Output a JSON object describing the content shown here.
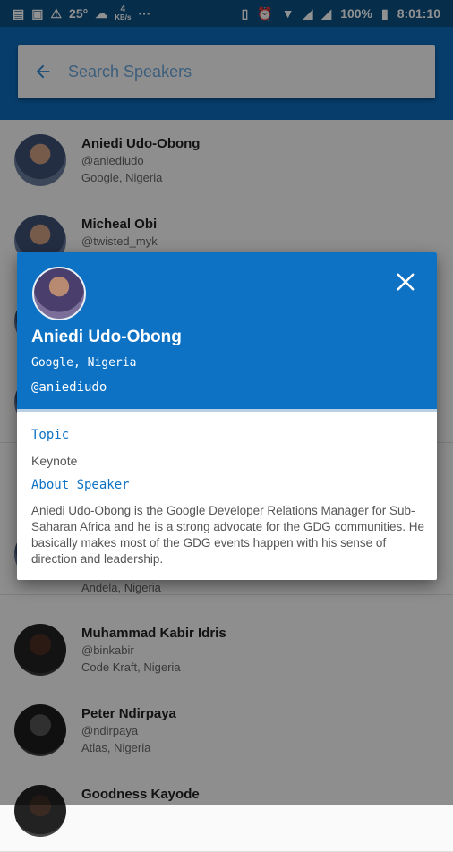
{
  "status_bar": {
    "temperature": "25°",
    "net_speed": "4",
    "net_unit": "KB/s",
    "dots": "···",
    "battery": "100%",
    "time": "8:01:10"
  },
  "search": {
    "placeholder": "Search Speakers"
  },
  "speakers": [
    {
      "name": "Aniedi Udo-Obong",
      "handle": "@aniediudo",
      "company": "Google, Nigeria"
    },
    {
      "name": "Micheal Obi",
      "handle": "@twisted_myk",
      "company": ""
    },
    {
      "name": "",
      "handle": "",
      "company": "Andela, Nigeria"
    },
    {
      "name": "Muhammad Kabir Idris",
      "handle": "@binkabir",
      "company": "Code Kraft, Nigeria"
    },
    {
      "name": "Peter Ndirpaya",
      "handle": "@ndirpaya",
      "company": "Atlas, Nigeria"
    },
    {
      "name": "Goodness Kayode",
      "handle": "",
      "company": ""
    }
  ],
  "dialog": {
    "name": "Aniedi Udo-Obong",
    "company": "Google, Nigeria",
    "handle": "@aniediudo",
    "topic_label": "Topic",
    "topic_value": "Keynote",
    "about_label": "About Speaker",
    "bio": "Aniedi Udo-Obong is the Google Developer Relations Manager for Sub-Saharan Africa and he is a strong advocate for the GDG communities. He basically makes most of the GDG events happen with his sense of direction and leadership."
  },
  "colors": {
    "primary": "#0d72c4",
    "status_bar": "#0b4f82",
    "accent_text": "#2f86d0"
  }
}
